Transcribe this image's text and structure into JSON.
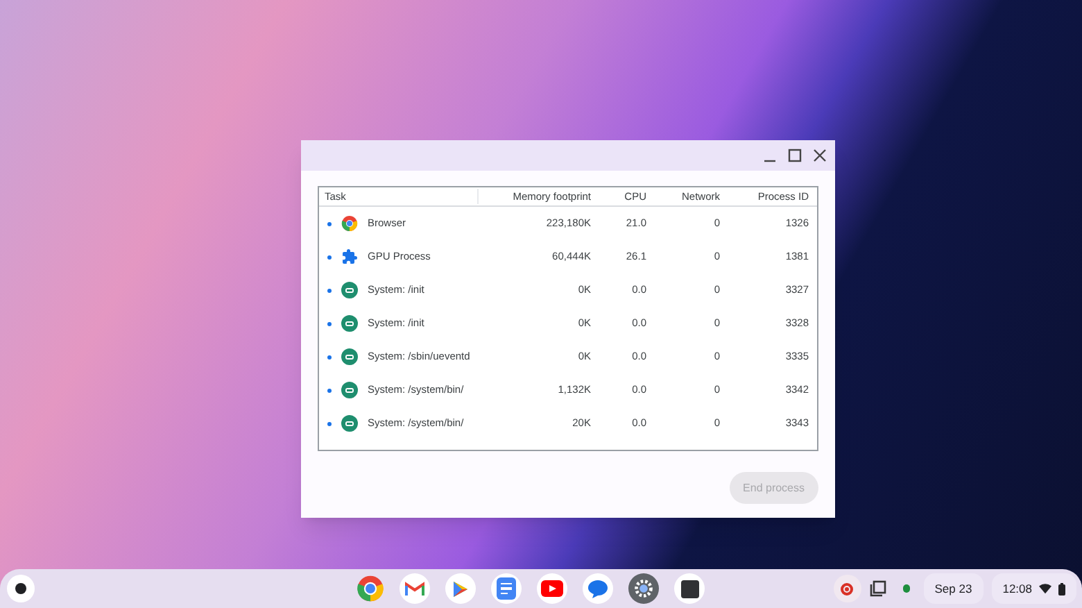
{
  "window": {
    "title_buttons": [
      {
        "kind": "minimize"
      },
      {
        "kind": "maximize"
      },
      {
        "kind": "close"
      }
    ]
  },
  "table": {
    "columns": [
      "Task",
      "Memory footprint",
      "CPU",
      "Network",
      "Process ID"
    ],
    "rows": [
      {
        "kind": "browser",
        "task": "Browser",
        "memory": "223,180K",
        "cpu": "21.0",
        "network": "0",
        "pid": "1326"
      },
      {
        "kind": "gpu",
        "task": "GPU Process",
        "memory": "60,444K",
        "cpu": "26.1",
        "network": "0",
        "pid": "1381"
      },
      {
        "kind": "system",
        "task": "System: /init",
        "memory": "0K",
        "cpu": "0.0",
        "network": "0",
        "pid": "3327"
      },
      {
        "kind": "system",
        "task": "System: /init",
        "memory": "0K",
        "cpu": "0.0",
        "network": "0",
        "pid": "3328"
      },
      {
        "kind": "system",
        "task": "System: /sbin/ueventd",
        "memory": "0K",
        "cpu": "0.0",
        "network": "0",
        "pid": "3335"
      },
      {
        "kind": "system",
        "task": "System: /system/bin/",
        "memory": "1,132K",
        "cpu": "0.0",
        "network": "0",
        "pid": "3342"
      },
      {
        "kind": "system",
        "task": "System: /system/bin/",
        "memory": "20K",
        "cpu": "0.0",
        "network": "0",
        "pid": "3343"
      }
    ]
  },
  "end_button": {
    "label": "End process",
    "disabled": true
  },
  "shelf": {
    "apps": [
      {
        "kind": "chrome"
      },
      {
        "kind": "gmail"
      },
      {
        "kind": "play"
      },
      {
        "kind": "docs"
      },
      {
        "kind": "youtube"
      },
      {
        "kind": "messages"
      },
      {
        "kind": "settings"
      },
      {
        "kind": "terminal"
      }
    ],
    "date": "Sep 23",
    "time": "12:08"
  }
}
